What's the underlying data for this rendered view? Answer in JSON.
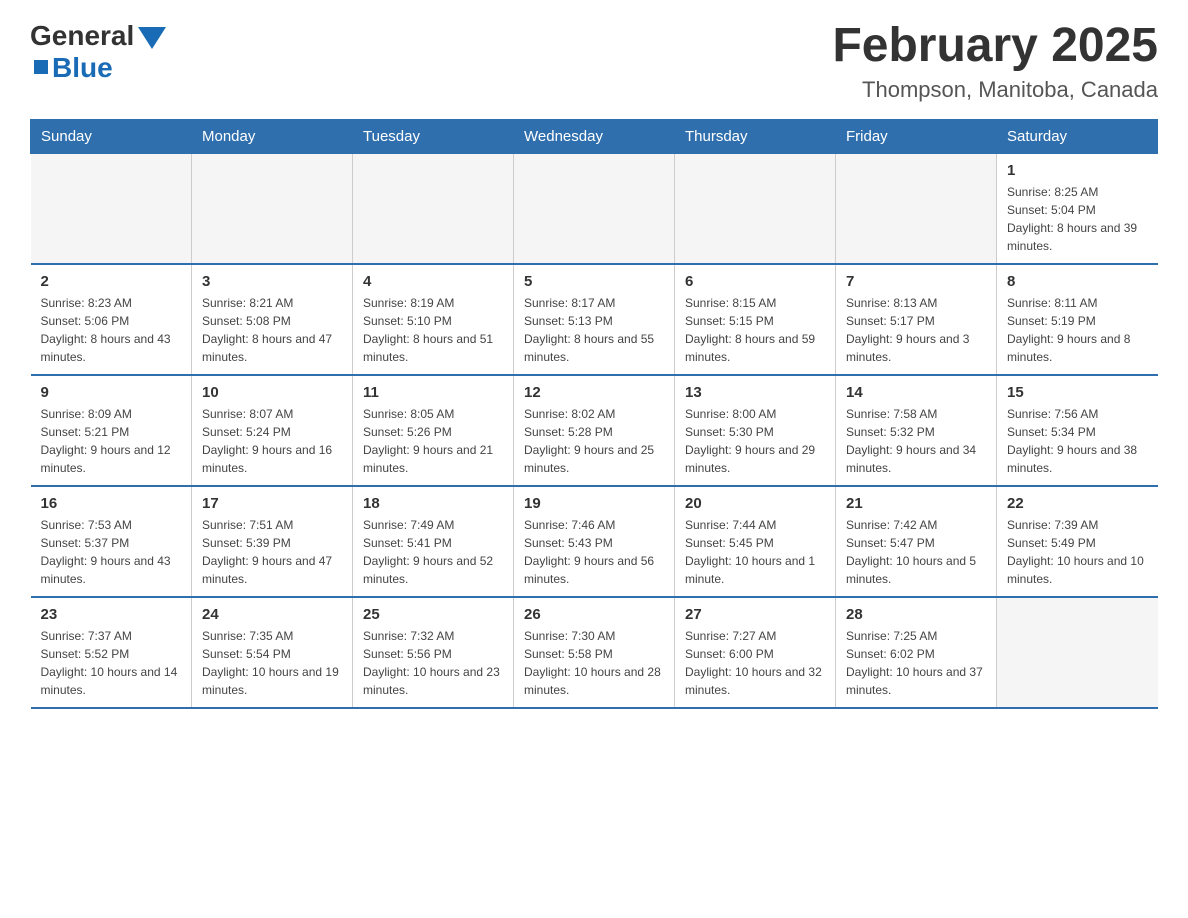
{
  "header": {
    "logo_general": "General",
    "logo_blue": "Blue",
    "month_year": "February 2025",
    "location": "Thompson, Manitoba, Canada"
  },
  "days_of_week": [
    "Sunday",
    "Monday",
    "Tuesday",
    "Wednesday",
    "Thursday",
    "Friday",
    "Saturday"
  ],
  "weeks": [
    [
      {
        "num": "",
        "info": ""
      },
      {
        "num": "",
        "info": ""
      },
      {
        "num": "",
        "info": ""
      },
      {
        "num": "",
        "info": ""
      },
      {
        "num": "",
        "info": ""
      },
      {
        "num": "",
        "info": ""
      },
      {
        "num": "1",
        "info": "Sunrise: 8:25 AM\nSunset: 5:04 PM\nDaylight: 8 hours and 39 minutes."
      }
    ],
    [
      {
        "num": "2",
        "info": "Sunrise: 8:23 AM\nSunset: 5:06 PM\nDaylight: 8 hours and 43 minutes."
      },
      {
        "num": "3",
        "info": "Sunrise: 8:21 AM\nSunset: 5:08 PM\nDaylight: 8 hours and 47 minutes."
      },
      {
        "num": "4",
        "info": "Sunrise: 8:19 AM\nSunset: 5:10 PM\nDaylight: 8 hours and 51 minutes."
      },
      {
        "num": "5",
        "info": "Sunrise: 8:17 AM\nSunset: 5:13 PM\nDaylight: 8 hours and 55 minutes."
      },
      {
        "num": "6",
        "info": "Sunrise: 8:15 AM\nSunset: 5:15 PM\nDaylight: 8 hours and 59 minutes."
      },
      {
        "num": "7",
        "info": "Sunrise: 8:13 AM\nSunset: 5:17 PM\nDaylight: 9 hours and 3 minutes."
      },
      {
        "num": "8",
        "info": "Sunrise: 8:11 AM\nSunset: 5:19 PM\nDaylight: 9 hours and 8 minutes."
      }
    ],
    [
      {
        "num": "9",
        "info": "Sunrise: 8:09 AM\nSunset: 5:21 PM\nDaylight: 9 hours and 12 minutes."
      },
      {
        "num": "10",
        "info": "Sunrise: 8:07 AM\nSunset: 5:24 PM\nDaylight: 9 hours and 16 minutes."
      },
      {
        "num": "11",
        "info": "Sunrise: 8:05 AM\nSunset: 5:26 PM\nDaylight: 9 hours and 21 minutes."
      },
      {
        "num": "12",
        "info": "Sunrise: 8:02 AM\nSunset: 5:28 PM\nDaylight: 9 hours and 25 minutes."
      },
      {
        "num": "13",
        "info": "Sunrise: 8:00 AM\nSunset: 5:30 PM\nDaylight: 9 hours and 29 minutes."
      },
      {
        "num": "14",
        "info": "Sunrise: 7:58 AM\nSunset: 5:32 PM\nDaylight: 9 hours and 34 minutes."
      },
      {
        "num": "15",
        "info": "Sunrise: 7:56 AM\nSunset: 5:34 PM\nDaylight: 9 hours and 38 minutes."
      }
    ],
    [
      {
        "num": "16",
        "info": "Sunrise: 7:53 AM\nSunset: 5:37 PM\nDaylight: 9 hours and 43 minutes."
      },
      {
        "num": "17",
        "info": "Sunrise: 7:51 AM\nSunset: 5:39 PM\nDaylight: 9 hours and 47 minutes."
      },
      {
        "num": "18",
        "info": "Sunrise: 7:49 AM\nSunset: 5:41 PM\nDaylight: 9 hours and 52 minutes."
      },
      {
        "num": "19",
        "info": "Sunrise: 7:46 AM\nSunset: 5:43 PM\nDaylight: 9 hours and 56 minutes."
      },
      {
        "num": "20",
        "info": "Sunrise: 7:44 AM\nSunset: 5:45 PM\nDaylight: 10 hours and 1 minute."
      },
      {
        "num": "21",
        "info": "Sunrise: 7:42 AM\nSunset: 5:47 PM\nDaylight: 10 hours and 5 minutes."
      },
      {
        "num": "22",
        "info": "Sunrise: 7:39 AM\nSunset: 5:49 PM\nDaylight: 10 hours and 10 minutes."
      }
    ],
    [
      {
        "num": "23",
        "info": "Sunrise: 7:37 AM\nSunset: 5:52 PM\nDaylight: 10 hours and 14 minutes."
      },
      {
        "num": "24",
        "info": "Sunrise: 7:35 AM\nSunset: 5:54 PM\nDaylight: 10 hours and 19 minutes."
      },
      {
        "num": "25",
        "info": "Sunrise: 7:32 AM\nSunset: 5:56 PM\nDaylight: 10 hours and 23 minutes."
      },
      {
        "num": "26",
        "info": "Sunrise: 7:30 AM\nSunset: 5:58 PM\nDaylight: 10 hours and 28 minutes."
      },
      {
        "num": "27",
        "info": "Sunrise: 7:27 AM\nSunset: 6:00 PM\nDaylight: 10 hours and 32 minutes."
      },
      {
        "num": "28",
        "info": "Sunrise: 7:25 AM\nSunset: 6:02 PM\nDaylight: 10 hours and 37 minutes."
      },
      {
        "num": "",
        "info": ""
      }
    ]
  ]
}
